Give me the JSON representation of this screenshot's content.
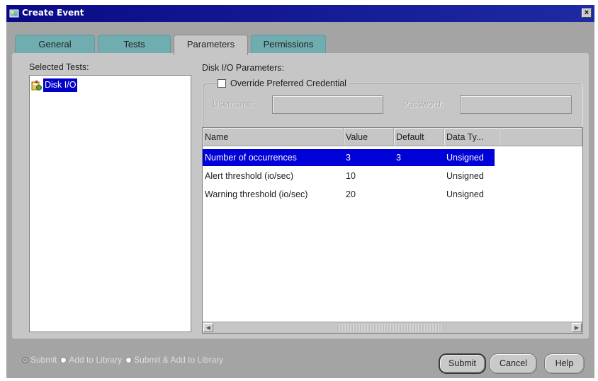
{
  "window": {
    "title": "Create Event",
    "close_label": "×"
  },
  "tabs": [
    {
      "label": "General",
      "active": false
    },
    {
      "label": "Tests",
      "active": false
    },
    {
      "label": "Parameters",
      "active": true
    },
    {
      "label": "Permissions",
      "active": false
    }
  ],
  "selected_tests": {
    "label": "Selected Tests:",
    "items": [
      {
        "label": "Disk I/O",
        "selected": true
      }
    ]
  },
  "parameters": {
    "label": "Disk I/O Parameters:",
    "credential": {
      "checkbox_label": "Override Preferred Credential",
      "checked": false,
      "username_label": "Username:",
      "username_value": "",
      "password_label": "Password:",
      "password_value": ""
    },
    "table": {
      "columns": [
        "Name",
        "Value",
        "Default",
        "Data Ty..."
      ],
      "rows": [
        {
          "name": "Number of occurrences",
          "value": "3",
          "default": "3",
          "type": "Unsigned",
          "selected": true
        },
        {
          "name": "Alert threshold (io/sec)",
          "value": "10",
          "default": "",
          "type": "Unsigned",
          "selected": false
        },
        {
          "name": "Warning threshold (io/sec)",
          "value": "20",
          "default": "",
          "type": "Unsigned",
          "selected": false
        }
      ]
    }
  },
  "footer": {
    "options": [
      {
        "label": "Submit",
        "selected": true
      },
      {
        "label": "Add to Library",
        "selected": false
      },
      {
        "label": "Submit & Add to Library",
        "selected": false
      }
    ],
    "buttons": {
      "submit": "Submit",
      "cancel": "Cancel",
      "help": "Help"
    }
  },
  "colors": {
    "title_bar": "#0a0a86",
    "tab_inactive": "#6fadb0",
    "selection": "#0000d8",
    "panel": "#c6c6c6",
    "frame": "#a4a4a4"
  }
}
